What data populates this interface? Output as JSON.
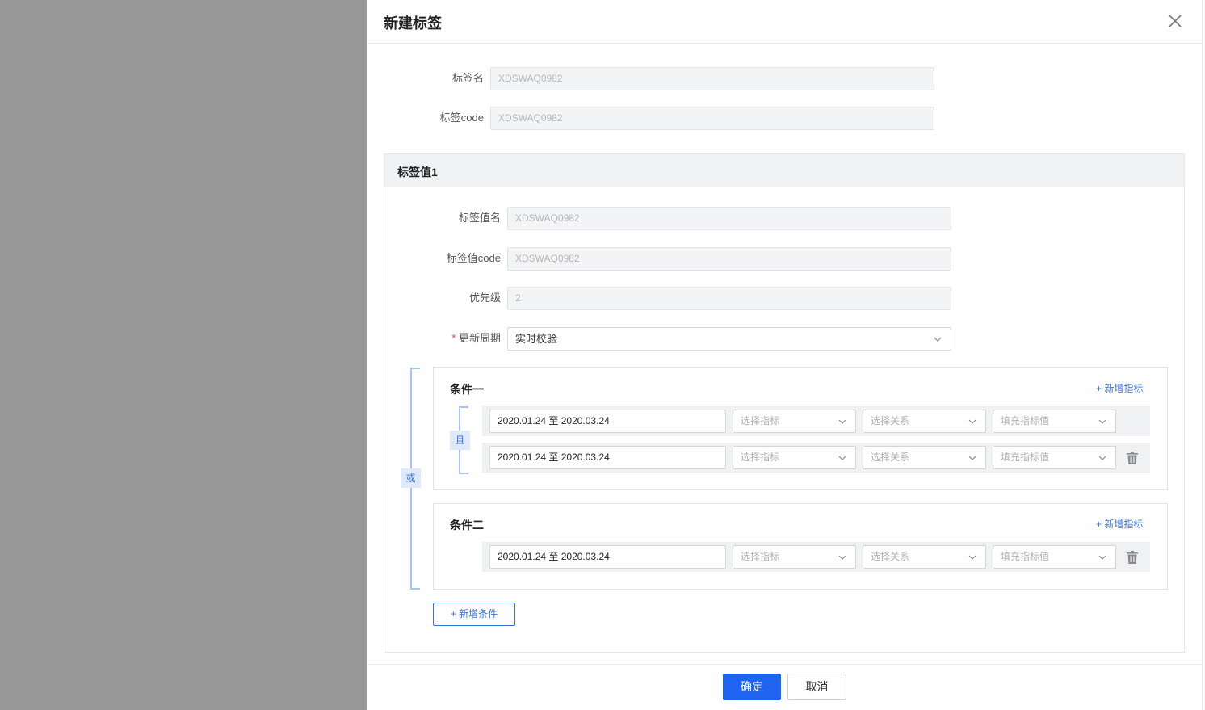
{
  "drawer": {
    "title": "新建标签"
  },
  "form": {
    "tag_name_label": "标签名",
    "tag_name_value": "XDSWAQ0982",
    "tag_code_label": "标签code",
    "tag_code_value": "XDSWAQ0982"
  },
  "tag_value": {
    "title": "标签值1",
    "name_label": "标签值名",
    "name_value": "XDSWAQ0982",
    "code_label": "标签值code",
    "code_value": "XDSWAQ0982",
    "priority_label": "优先级",
    "priority_value": "2",
    "required_mark": "*",
    "update_label": "更新周期",
    "update_value": "实时校验"
  },
  "logic": {
    "or_label": "或",
    "and_label": "且"
  },
  "conditions": [
    {
      "title": "条件一",
      "add_metric": "+ 新增指标",
      "rows": [
        {
          "date_range": "2020.01.24 至 2020.03.24",
          "metric_placeholder": "选择指标",
          "relation_placeholder": "选择关系",
          "value_placeholder": "填充指标值"
        },
        {
          "date_range": "2020.01.24 至 2020.03.24",
          "metric_placeholder": "选择指标",
          "relation_placeholder": "选择关系",
          "value_placeholder": "填充指标值"
        }
      ]
    },
    {
      "title": "条件二",
      "add_metric": "+ 新增指标",
      "rows": [
        {
          "date_range": "2020.01.24 至 2020.03.24",
          "metric_placeholder": "选择指标",
          "relation_placeholder": "选择关系",
          "value_placeholder": "填充指标值"
        }
      ]
    }
  ],
  "add_condition_label": "+ 新增条件",
  "footer": {
    "confirm_label": "确定",
    "cancel_label": "取消"
  },
  "colors": {
    "primary": "#1f64f0",
    "overlay": "#999999",
    "bracket": "#a9c3f2"
  }
}
